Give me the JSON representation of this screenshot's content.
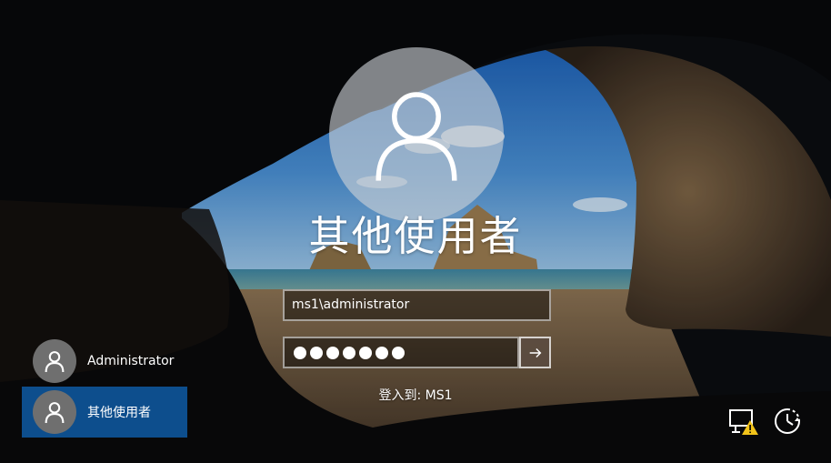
{
  "login": {
    "title": "其他使用者",
    "username_value": "ms1\\administrator",
    "password_length": 7,
    "sign_in_to": "登入到: MS1"
  },
  "user_list": [
    {
      "label": "Administrator",
      "selected": false
    },
    {
      "label": "其他使用者",
      "selected": true
    }
  ],
  "system_icons": [
    "network-warning-icon",
    "ease-of-access-icon"
  ],
  "colors": {
    "selected_tile": "#0d4e8d",
    "avatar_big": "#c8cdd2",
    "avatar_small": "#6f6f6f",
    "warning": "#f2c31a"
  }
}
